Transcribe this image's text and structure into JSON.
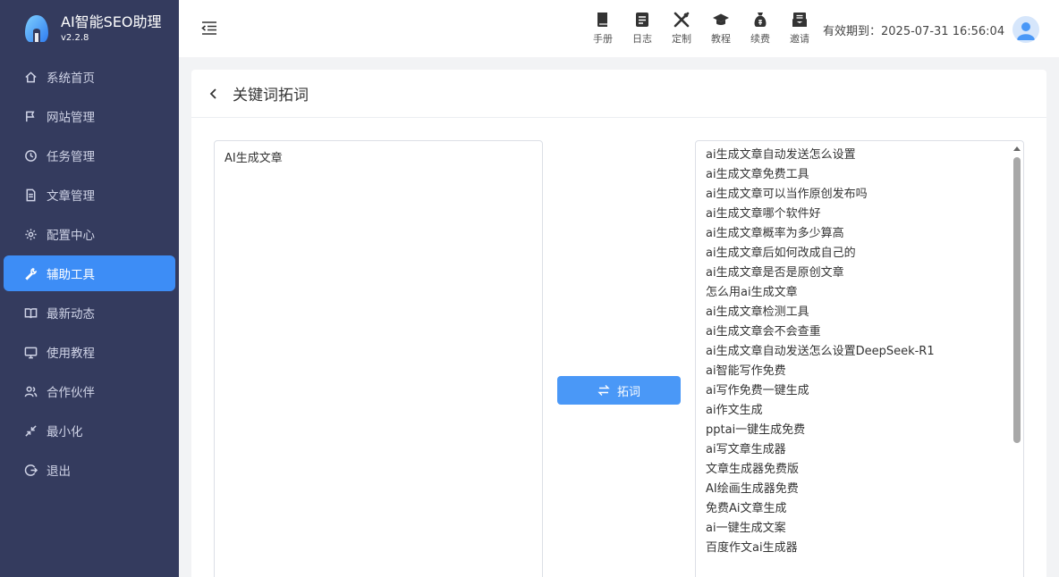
{
  "brand": {
    "name": "AI智能SEO助理",
    "version": "v2.2.8"
  },
  "sidebar": {
    "items": [
      {
        "label": "系统首页",
        "icon": "home-icon"
      },
      {
        "label": "网站管理",
        "icon": "flag-icon"
      },
      {
        "label": "任务管理",
        "icon": "clock-icon"
      },
      {
        "label": "文章管理",
        "icon": "document-icon"
      },
      {
        "label": "配置中心",
        "icon": "gear-icon"
      },
      {
        "label": "辅助工具",
        "icon": "wrench-icon",
        "active": true
      },
      {
        "label": "最新动态",
        "icon": "book-icon"
      },
      {
        "label": "使用教程",
        "icon": "monitor-icon"
      },
      {
        "label": "合作伙伴",
        "icon": "users-icon"
      },
      {
        "label": "最小化",
        "icon": "minimize-icon"
      },
      {
        "label": "退出",
        "icon": "logout-icon"
      }
    ]
  },
  "header": {
    "tools": [
      {
        "label": "手册",
        "icon": "manual-icon"
      },
      {
        "label": "日志",
        "icon": "log-icon"
      },
      {
        "label": "定制",
        "icon": "customize-icon"
      },
      {
        "label": "教程",
        "icon": "graduation-cap-icon"
      },
      {
        "label": "续费",
        "icon": "money-bag-icon"
      },
      {
        "label": "邀请",
        "icon": "invite-icon"
      }
    ],
    "expiry_label": "有效期到：",
    "expiry_value": "2025-07-31 16:56:04"
  },
  "page": {
    "title": "关键词拓词",
    "input_value": "AI生成文章",
    "expand_label": "拓词",
    "results": [
      "ai生成文章自动发送怎么设置",
      "ai生成文章免费工具",
      "ai生成文章可以当作原创发布吗",
      "ai生成文章哪个软件好",
      "ai生成文章概率为多少算高",
      "ai生成文章后如何改成自己的",
      "ai生成文章是否是原创文章",
      "怎么用ai生成文章",
      "ai生成文章检测工具",
      "ai生成文章会不会查重",
      "ai生成文章自动发送怎么设置DeepSeek-R1",
      "ai智能写作免费",
      "ai写作免费一键生成",
      "ai作文生成",
      "pptai一键生成免费",
      "ai写文章生成器",
      "文章生成器免费版",
      "AI绘画生成器免费",
      "免费Ai文章生成",
      "ai一键生成文案",
      "百度作文ai生成器"
    ]
  },
  "colors": {
    "sidebar_bg": "#343b5e",
    "accent": "#3d8df6",
    "button": "#4a98f7"
  }
}
